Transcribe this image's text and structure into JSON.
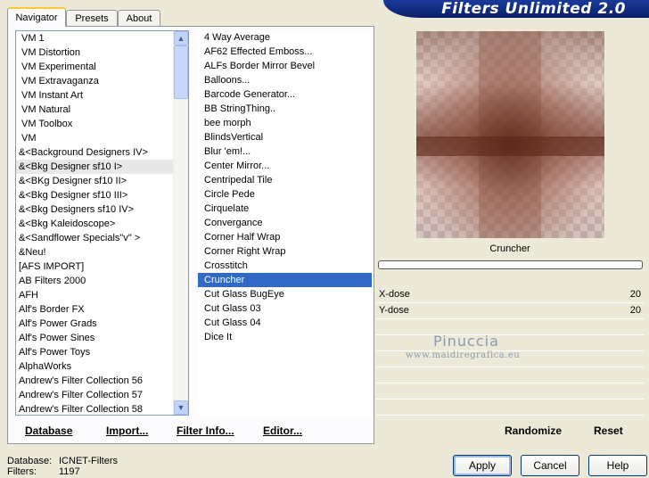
{
  "header": {
    "title": "Filters Unlimited 2.0"
  },
  "tabs": [
    "Navigator",
    "Presets",
    "About"
  ],
  "categories": [
    "VM 1",
    "VM Distortion",
    "VM Experimental",
    "VM Extravaganza",
    "VM Instant Art",
    "VM Natural",
    "VM Toolbox",
    "VM",
    "&<Background Designers IV>",
    "&<Bkg Designer sf10 I>",
    "&<BKg Designer sf10 II>",
    "&<Bkg Designer sf10 III>",
    "&<Bkg Designers sf10 IV>",
    "&<Bkg Kaleidoscope>",
    "&<Sandflower Specials\"v\" >",
    "&Neu!",
    "[AFS IMPORT]",
    "AB Filters 2000",
    "AFH",
    "Alf's Border FX",
    "Alf's Power Grads",
    "Alf's Power Sines",
    "Alf's Power Toys",
    "AlphaWorks",
    "Andrew's Filter Collection 56",
    "Andrew's Filter Collection 57",
    "Andrew's Filter Collection 58"
  ],
  "filters": [
    "4 Way Average",
    "AF62 Effected Emboss...",
    "ALFs Border Mirror Bevel",
    "Balloons...",
    "Barcode Generator...",
    "BB StringThing..",
    "bee morph",
    "BlindsVertical",
    "Blur 'em!...",
    "Center Mirror...",
    "Centripedal Tile",
    "Circle Pede",
    "Cirquelate",
    "Convergance",
    "Corner Half Wrap",
    "Corner Right Wrap",
    "Crosstitch",
    "Cruncher",
    "Cut Glass  BugEye",
    "Cut Glass 03",
    "Cut Glass 04",
    "Dice It"
  ],
  "left_buttons": [
    "Database",
    "Import...",
    "Filter Info...",
    "Editor..."
  ],
  "preview": {
    "filter_name": "Cruncher"
  },
  "params": [
    {
      "label": "X-dose",
      "value": "20"
    },
    {
      "label": "Y-dose",
      "value": "20"
    }
  ],
  "watermark": {
    "line1": "Pinuccia",
    "line2": "www.maidiregrafica.eu"
  },
  "right_buttons": [
    "Randomize",
    "Reset"
  ],
  "footer": {
    "database_label": "Database:",
    "database_value": "ICNET-Filters",
    "filters_label": "Filters:",
    "filters_value": "1197"
  },
  "dialog_buttons": {
    "apply": "Apply",
    "cancel": "Cancel",
    "help": "Help"
  }
}
